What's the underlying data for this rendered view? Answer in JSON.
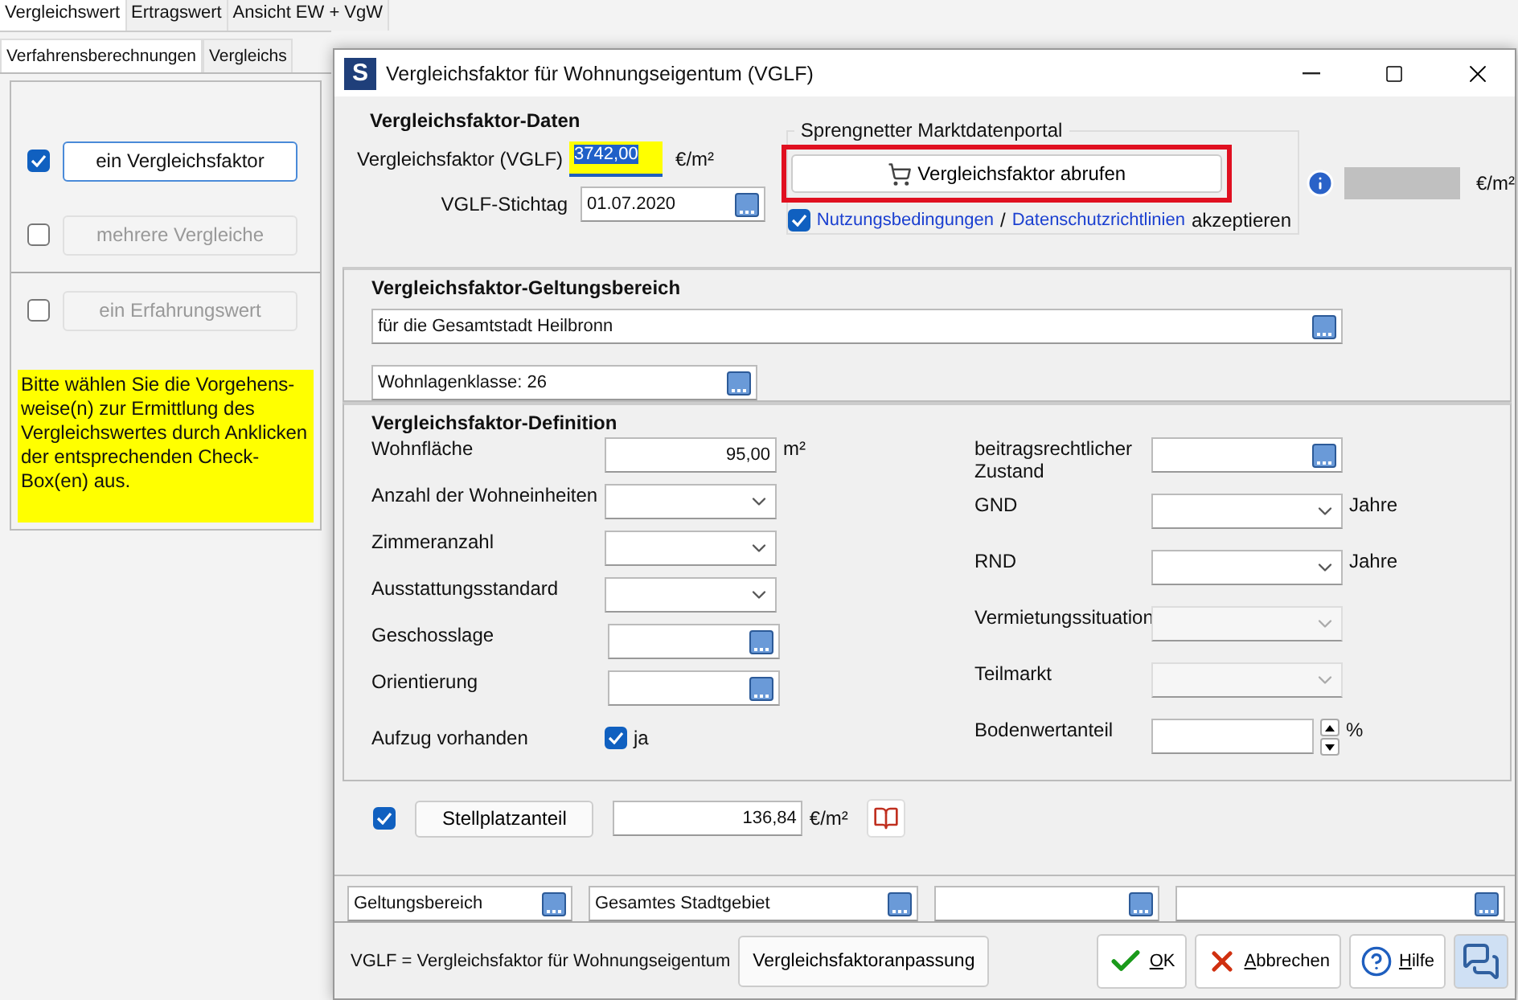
{
  "app": {
    "tabs": [
      {
        "label": "Vergleichswert",
        "selected": true
      },
      {
        "label": "Ertragswert",
        "selected": false
      },
      {
        "label": "Ansicht EW + VgW",
        "selected": false
      }
    ],
    "subtabs": [
      {
        "label": "Verfahrensberechnungen",
        "selected": true
      },
      {
        "label": "Vergleichs",
        "selected": false
      }
    ],
    "options": [
      {
        "label": "ein Vergleichsfaktor",
        "checked": true,
        "disabled": false
      },
      {
        "label": "mehrere Vergleiche",
        "checked": false,
        "disabled": true
      },
      {
        "label": "ein Erfahrungswert",
        "checked": false,
        "disabled": true
      }
    ],
    "hint": "Bitte wählen Sie die Vorgehens-weise(n) zur Ermittlung des Vergleichswertes durch Anklicken der entsprechenden Check-Box(en) aus."
  },
  "dialog": {
    "title": "Vergleichsfaktor für Wohnungseigentum (VGLF)",
    "logo": "S",
    "data": {
      "heading": "Vergleichsfaktor-Daten",
      "factor_label": "Vergleichsfaktor (VGLF)",
      "factor_value": "3742,00",
      "factor_unit": "€/m²",
      "date_label": "VGLF-Stichtag",
      "date_value": "01.07.2020"
    },
    "portal": {
      "legend": "Sprengnetter Marktdatenportal",
      "button": "Vergleichsfaktor abrufen",
      "unit": "€/m²",
      "accept_checked": true,
      "link1": "Nutzungsbedingungen",
      "separator": "/",
      "link2": "Datenschutzrichtlinien",
      "accept_text": "akzeptieren"
    },
    "scope": {
      "heading": "Vergleichsfaktor-Geltungsbereich",
      "area": "für die Gesamtstadt Heilbronn",
      "class": "Wohnlagenklasse: 26"
    },
    "definition": {
      "heading": "Vergleichsfaktor-Definition",
      "left": [
        {
          "label": "Wohnfläche",
          "kind": "number",
          "value": "95,00",
          "unit": "m²"
        },
        {
          "label": "Anzahl der Wohneinheiten",
          "kind": "select",
          "disabled": false
        },
        {
          "label": "Zimmeranzahl",
          "kind": "select",
          "disabled": false
        },
        {
          "label": "Ausstattungsstandard",
          "kind": "select",
          "disabled": false
        },
        {
          "label": "Geschosslage",
          "kind": "lookup"
        },
        {
          "label": "Orientierung",
          "kind": "lookup"
        },
        {
          "label": "Aufzug vorhanden",
          "kind": "checkbox",
          "checked": true,
          "check_label": "ja"
        }
      ],
      "right": [
        {
          "label": "beitragsrechtlicher Zustand",
          "kind": "lookup"
        },
        {
          "label": "GND",
          "kind": "select",
          "disabled": false,
          "unit": "Jahre"
        },
        {
          "label": "RND",
          "kind": "select",
          "disabled": false,
          "unit": "Jahre"
        },
        {
          "label": "Vermietungssituation",
          "kind": "select",
          "disabled": true
        },
        {
          "label": "Teilmarkt",
          "kind": "select",
          "disabled": true
        },
        {
          "label": "Bodenwertanteil",
          "kind": "spinner",
          "unit": "%"
        }
      ]
    },
    "parking": {
      "checked": true,
      "button": "Stellplatzanteil",
      "value": "136,84",
      "unit": "€/m²"
    },
    "filters": [
      {
        "kind": "lookup",
        "value": "Geltungsbereich"
      },
      {
        "kind": "lookup",
        "value": "Gesamtes Stadtgebiet"
      },
      {
        "kind": "lookup"
      },
      {
        "kind": "lookup"
      }
    ],
    "footer": {
      "note": "VGLF = Vergleichsfaktor für Wohnungseigentum",
      "adjust": "Vergleichsfaktoranpassung",
      "buttons": [
        {
          "kind": "ok",
          "label": "OK"
        },
        {
          "kind": "cancel",
          "label": "Abbrechen"
        },
        {
          "kind": "help",
          "label": "Hilfe"
        }
      ]
    }
  }
}
